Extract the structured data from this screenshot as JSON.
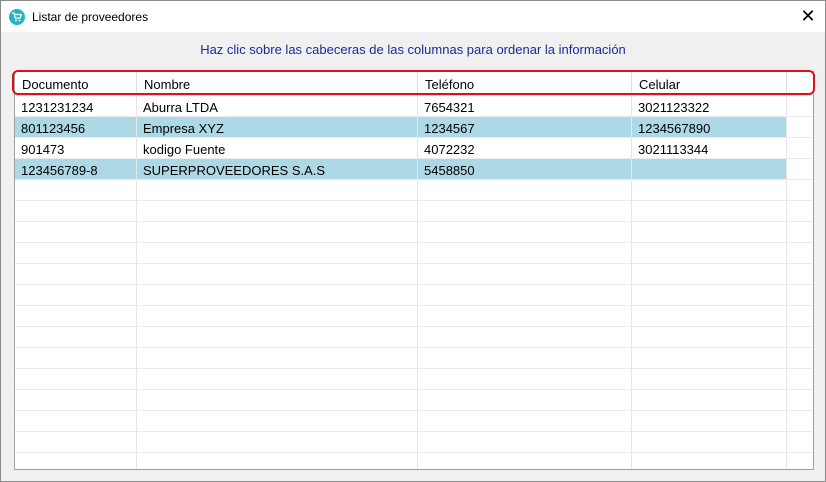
{
  "window": {
    "title": "Listar de proveedores",
    "close_glyph": "✕"
  },
  "hint": "Haz clic sobre las cabeceras de las columnas para ordenar la información",
  "table": {
    "columns": [
      "Documento",
      "Nombre",
      "Teléfono",
      "Celular"
    ],
    "rows": [
      [
        "1231231234",
        "Aburra LTDA",
        "7654321",
        "3021123322"
      ],
      [
        "801123456",
        "Empresa XYZ",
        "1234567",
        "1234567890"
      ],
      [
        "901473",
        "kodigo Fuente",
        "4072232",
        "3021113344"
      ],
      [
        "123456789-8",
        "SUPERPROVEEDORES S.A.S",
        "5458850",
        ""
      ]
    ],
    "alt_row_color": "#add8e6",
    "header_highlight_color": "#e0101a"
  },
  "colors": {
    "hint_text": "#1a2a9a",
    "app_icon": "#1fb5c9"
  },
  "icons": {
    "app": "cart-icon",
    "close": "close-icon"
  }
}
